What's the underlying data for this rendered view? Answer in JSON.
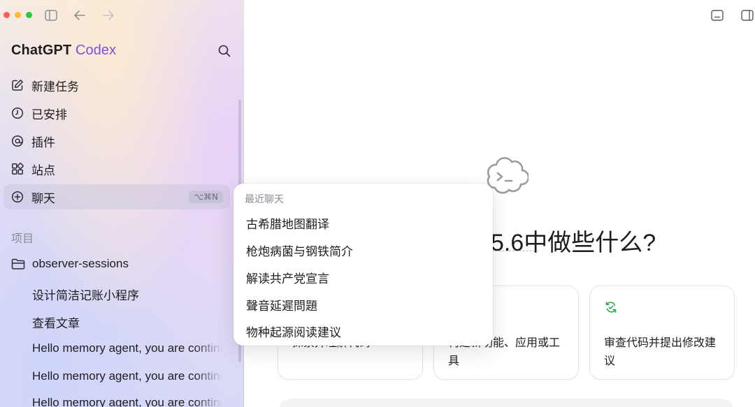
{
  "window": {
    "traffic_lights": {
      "close": "#ff5f57",
      "minimize": "#febc2e",
      "zoom": "#28c840"
    }
  },
  "sidebar": {
    "brand": {
      "name": "ChatGPT",
      "product": "Codex",
      "accent": "#7b4fe0"
    },
    "nav": [
      {
        "label": "新建任务",
        "icon": "edit-icon"
      },
      {
        "label": "已安排",
        "icon": "clock-icon"
      },
      {
        "label": "插件",
        "icon": "at-sign-icon"
      },
      {
        "label": "站点",
        "icon": "grid-icon"
      },
      {
        "label": "聊天",
        "icon": "plus-circle-icon",
        "shortcut": "⌥⌘N",
        "active": true
      }
    ],
    "projects_title": "项目",
    "project": {
      "label": "observer-sessions",
      "icon": "folder-icon"
    },
    "threads": [
      "设计简洁记账小程序",
      "查看文章",
      "Hello memory agent, you are continuing",
      "Hello memory agent, you are continuing",
      "Hello memory agent, you are continuing"
    ]
  },
  "main": {
    "headline": "5.6中做些什么?",
    "cards": [
      {
        "text": "探索并理解代码",
        "icon": ""
      },
      {
        "text": "构建新功能、应用或工具",
        "icon": ""
      },
      {
        "text": "审查代码并提出修改建议",
        "icon": "review-refresh-icon",
        "icon_color": "#34a853"
      }
    ]
  },
  "popup": {
    "title": "最近聊天",
    "items": [
      "古希腊地图翻译",
      "枪炮病菌与钢铁简介",
      "解读共产党宣言",
      "聲音延遲問題",
      "物种起源阅读建议"
    ]
  }
}
